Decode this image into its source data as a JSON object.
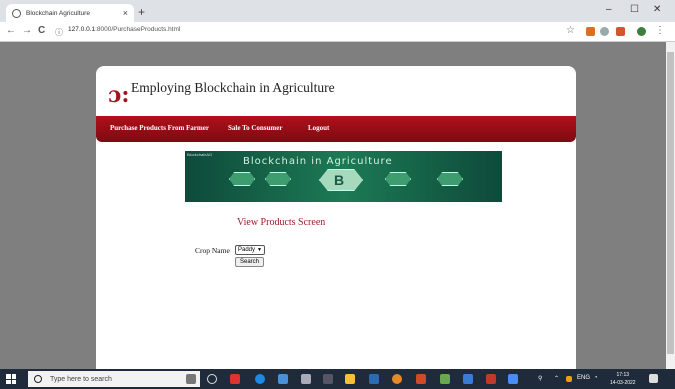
{
  "browser": {
    "tab_title": "Blockchain Agriculture",
    "tab_close": "×",
    "new_tab": "+",
    "nav": {
      "back": "←",
      "forward": "→",
      "reload": "C",
      "info": "ⓘ"
    },
    "url_host": "127.0.0.1",
    "url_path": ":8000/PurchaseProducts.html",
    "window": {
      "minimize": "–",
      "maximize": "☐",
      "close": "✕"
    }
  },
  "page": {
    "logo_mark": "ɔ:",
    "site_title": "Employing Blockchain in Agriculture",
    "nav": [
      {
        "label": "Purchase Products From Farmer"
      },
      {
        "label": "Sale To Consumer"
      },
      {
        "label": "Logout"
      }
    ],
    "banner": {
      "tag": "BlockchainAG",
      "title": "Blockchain in Agriculture",
      "center_mark": "B"
    },
    "screen_title": "View Products Screen",
    "form": {
      "crop_label": "Crop Name",
      "crop_value": "Paddy",
      "search_label": "Search"
    }
  },
  "taskbar": {
    "search_placeholder": "Type here to search",
    "tray_lang": "ENG",
    "time": "17:13",
    "date": "14-03-2022"
  },
  "colors": {
    "accent": "#a4141e",
    "nav_bg": "#9a0f18",
    "taskbar": "#1f2b3a"
  }
}
